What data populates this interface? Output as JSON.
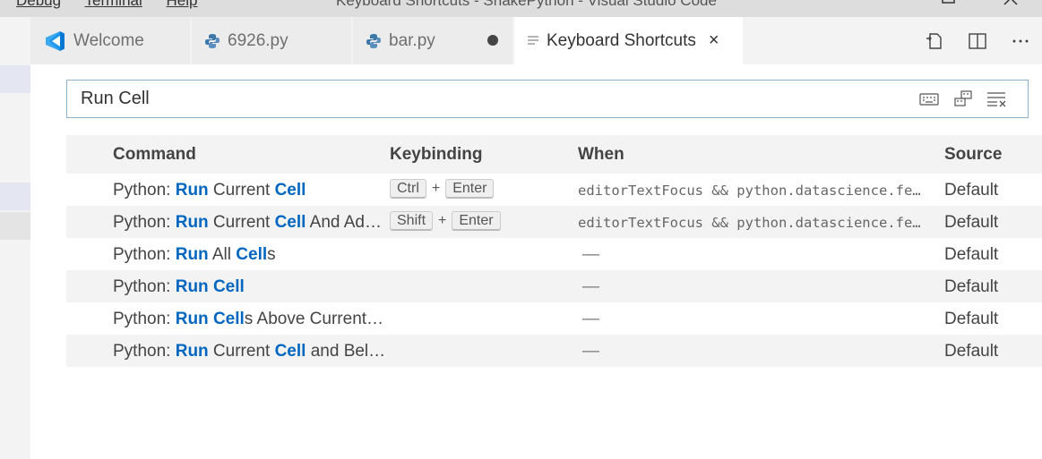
{
  "titlebar": {
    "menu": [
      "Debug",
      "Terminal",
      "Help"
    ],
    "window_title": "Keyboard Shortcuts - SnakePython - Visual Studio Code",
    "restore_icon": "restore-icon",
    "close_icon": "close-icon"
  },
  "tabs": [
    {
      "label": "Welcome",
      "icon": "vscode-icon",
      "active": false
    },
    {
      "label": "6926.py",
      "icon": "python-icon",
      "active": false
    },
    {
      "label": "bar.py",
      "icon": "python-icon",
      "active": false,
      "dirty": true
    },
    {
      "label": "Keyboard Shortcuts",
      "icon": "preview-icon",
      "active": true,
      "close": "×"
    }
  ],
  "editor_actions": [
    "open-json-icon",
    "split-editor-icon",
    "more-actions-icon"
  ],
  "search": {
    "value": "Run Cell",
    "icons": [
      "record-keys-icon",
      "sort-by-precedence-icon",
      "clear-input-icon"
    ]
  },
  "table": {
    "headers": {
      "command": "Command",
      "keybinding": "Keybinding",
      "when": "When",
      "source": "Source"
    },
    "rows": [
      {
        "prefix": "Python: ",
        "parts": [
          [
            "Run",
            true
          ],
          [
            " Current ",
            false
          ],
          [
            "Cell",
            true
          ]
        ],
        "keys": [
          "Ctrl",
          "Enter"
        ],
        "when": "editorTextFocus && python.datascience.fe…",
        "source": "Default"
      },
      {
        "prefix": "Python: ",
        "parts": [
          [
            "Run",
            true
          ],
          [
            " Current ",
            false
          ],
          [
            "Cell",
            true
          ],
          [
            " And Ad…",
            false
          ]
        ],
        "keys": [
          "Shift",
          "Enter"
        ],
        "when": "editorTextFocus && python.datascience.fe…",
        "source": "Default"
      },
      {
        "prefix": "Python: ",
        "parts": [
          [
            "Run",
            true
          ],
          [
            " All ",
            false
          ],
          [
            "Cell",
            true
          ],
          [
            "s",
            false
          ]
        ],
        "keys": [],
        "when": "—",
        "source": "Default"
      },
      {
        "prefix": "Python: ",
        "parts": [
          [
            "Run",
            true
          ],
          [
            " ",
            false
          ],
          [
            "Cell",
            true
          ]
        ],
        "keys": [],
        "when": "—",
        "source": "Default"
      },
      {
        "prefix": "Python: ",
        "parts": [
          [
            "Run",
            true
          ],
          [
            " ",
            false
          ],
          [
            "Cell",
            true
          ],
          [
            "s Above Current…",
            false
          ]
        ],
        "keys": [],
        "when": "—",
        "source": "Default"
      },
      {
        "prefix": "Python: ",
        "parts": [
          [
            "Run",
            true
          ],
          [
            " Current ",
            false
          ],
          [
            "Cell",
            true
          ],
          [
            " and Bel…",
            false
          ]
        ],
        "keys": [],
        "when": "—",
        "source": "Default"
      }
    ]
  },
  "colors": {
    "accent": "#0066bf",
    "search_border": "#8fb2cf",
    "row_alt": "#f3f3f3"
  }
}
